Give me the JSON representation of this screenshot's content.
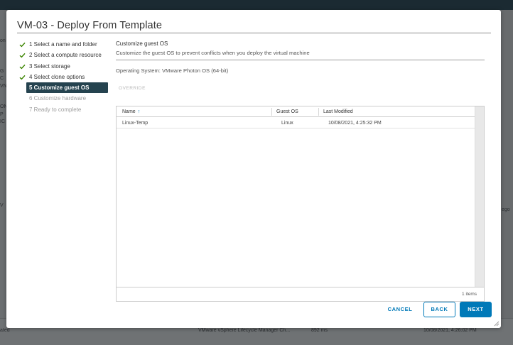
{
  "background": {
    "left_fragments": [
      "on",
      "G",
      "C",
      "VN",
      "ON",
      "P",
      "IC",
      "V"
    ],
    "right_fragment": "ego",
    "row": {
      "col1": "ated",
      "col2": "VMware vSphere Lifecycle Manager Ch...",
      "col3": "892 ms",
      "col4": "10/08/2021, 4:26:02 PM"
    }
  },
  "dialog": {
    "title": "VM-03 - Deploy From Template"
  },
  "steps": [
    {
      "label": "1 Select a name and folder",
      "state": "done"
    },
    {
      "label": "2 Select a compute resource",
      "state": "done"
    },
    {
      "label": "3 Select storage",
      "state": "done"
    },
    {
      "label": "4 Select clone options",
      "state": "done"
    },
    {
      "label": "5 Customize guest OS",
      "state": "active"
    },
    {
      "label": "6 Customize hardware",
      "state": "disabled"
    },
    {
      "label": "7 Ready to complete",
      "state": "disabled"
    }
  ],
  "main": {
    "section_title": "Customize guest OS",
    "section_subtitle": "Customize the guest OS to prevent conflicts when you deploy the virtual machine",
    "operating_system": "Operating System: VMware Photon OS (64-bit)",
    "override_label": "OVERRIDE"
  },
  "grid": {
    "columns": [
      "Name",
      "Guest OS",
      "Last Modified"
    ],
    "sort_icon": "sort-ascending-icon",
    "rows": [
      {
        "name": "Linux-Temp",
        "guest_os": "Linux",
        "last_modified": "10/08/2021, 4:25:32 PM"
      }
    ],
    "footer_count": "1 items"
  },
  "buttons": {
    "cancel": "CANCEL",
    "back": "BACK",
    "next": "NEXT"
  },
  "colors": {
    "accent": "#0079b8",
    "active_step_bg": "#25434f",
    "check_green": "#3c8500",
    "disabled_text": "#9e9e9e"
  }
}
